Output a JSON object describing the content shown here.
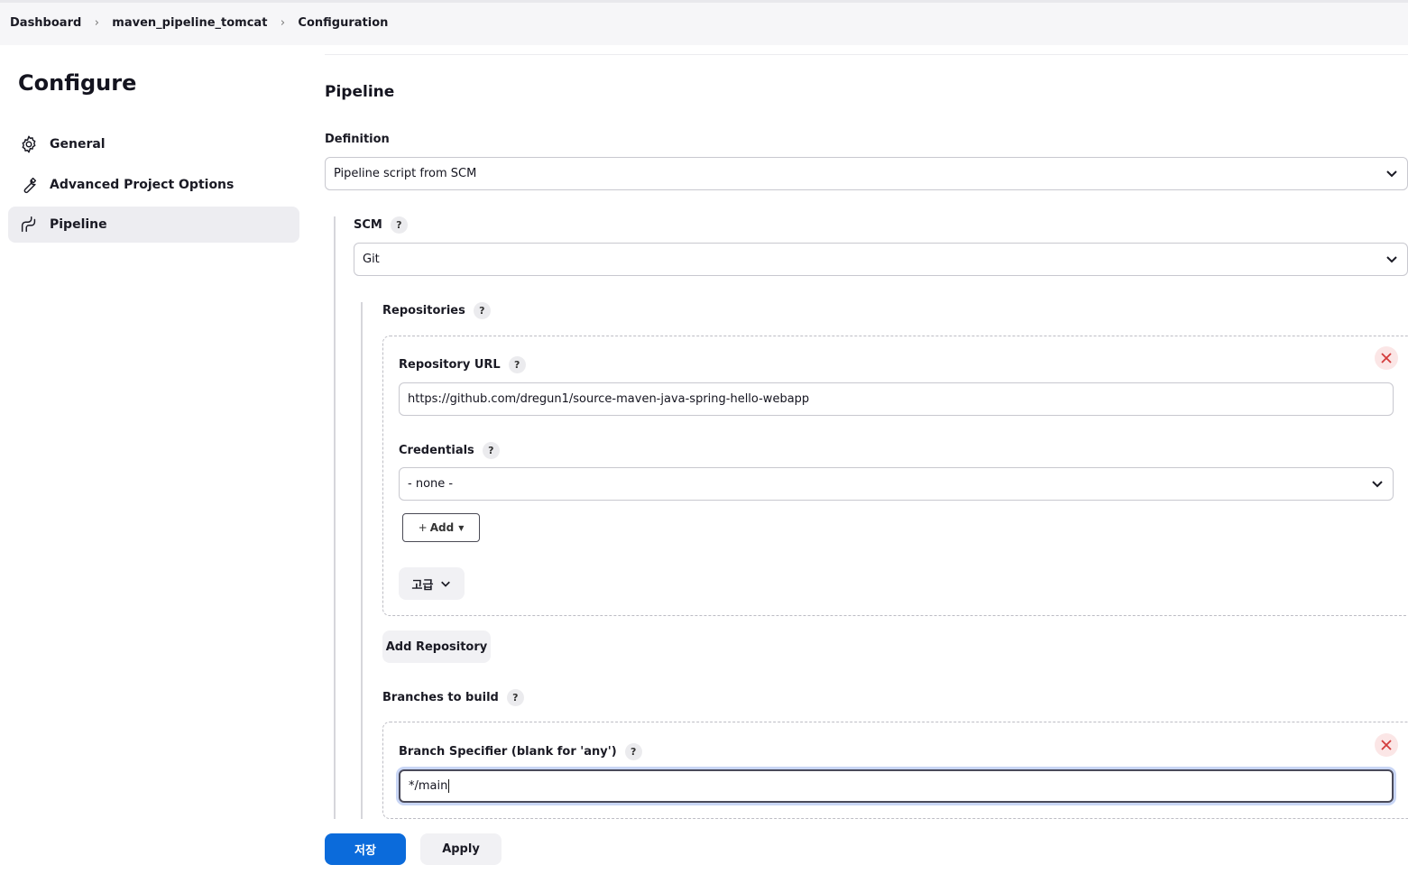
{
  "breadcrumb": {
    "items": [
      "Dashboard",
      "maven_pipeline_tomcat",
      "Configuration"
    ]
  },
  "sidebar": {
    "title": "Configure",
    "items": [
      {
        "label": "General",
        "icon": "gear-icon"
      },
      {
        "label": "Advanced Project Options",
        "icon": "wrench-icon"
      },
      {
        "label": "Pipeline",
        "icon": "pipeline-icon",
        "active": true
      }
    ]
  },
  "main": {
    "section_title": "Pipeline",
    "definition": {
      "label": "Definition",
      "value": "Pipeline script from SCM"
    },
    "scm": {
      "label": "SCM",
      "help": "?",
      "value": "Git"
    },
    "repositories": {
      "label": "Repositories",
      "help": "?",
      "repository_url": {
        "label": "Repository URL",
        "help": "?",
        "value": "https://github.com/dregun1/source-maven-java-spring-hello-webapp"
      },
      "credentials": {
        "label": "Credentials",
        "help": "?",
        "value": "- none -"
      },
      "add_button": "Add",
      "advanced_button": "고급",
      "add_repository_button": "Add Repository"
    },
    "branches": {
      "label": "Branches to build",
      "help": "?",
      "specifier": {
        "label": "Branch Specifier (blank for 'any')",
        "help": "?",
        "value": "*/main"
      }
    }
  },
  "footer": {
    "save_label": "저장",
    "apply_label": "Apply"
  },
  "colors": {
    "primary": "#0b6bdb",
    "danger": "#d43b3b"
  }
}
